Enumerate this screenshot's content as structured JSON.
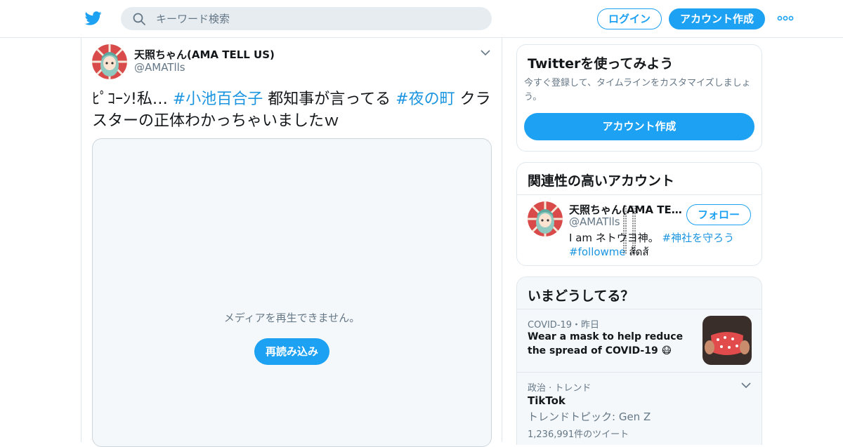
{
  "topbar": {
    "search_placeholder": "キーワード検索",
    "login_label": "ログイン",
    "signup_label": "アカウント作成",
    "brand_color": "#1da1f2"
  },
  "tweet": {
    "author_name": "天照ちゃん(AMA TELL US)",
    "author_handle": "@AMATlls",
    "text_parts": {
      "p1": "ﾋﾟｺｰﾝ!私… ",
      "h1": "#小池百合子",
      "p2": " 都知事が言ってる ",
      "h2": "#夜の町",
      "p3": " クラスターの正体わかっちゃいましたｗ"
    },
    "media_message": "メディアを再生できません。",
    "reload_label": "再読み込み"
  },
  "sidebar": {
    "signup_card": {
      "title": "Twitterを使ってみよう",
      "subtitle": "今すぐ登録して、タイムラインをカスタマイズしましょう。",
      "button_label": "アカウント作成"
    },
    "related": {
      "title": "関連性の高いアカウント",
      "name": "天照ちゃん(AMA TELL US)",
      "handle": "@AMATlls",
      "follow_label": "フォロー",
      "bio_text": "I am ネトウヨ神。 ",
      "bio_hashtag1": "#神社を守ろう",
      "bio_hashtag2": "#followme",
      "bio_tail": " ส้ดส้"
    },
    "trends": {
      "title": "いまどうしてる？",
      "items": [
        {
          "meta": "COVID-19・昨日",
          "title": "Wear a mask to help reduce the spread of COVID-19 😷"
        },
        {
          "meta": "政治 · トレンド",
          "title": "TikTok",
          "subtitle": "トレンドトピック: Gen Z",
          "count": "1,236,991件のツイート"
        }
      ]
    }
  }
}
